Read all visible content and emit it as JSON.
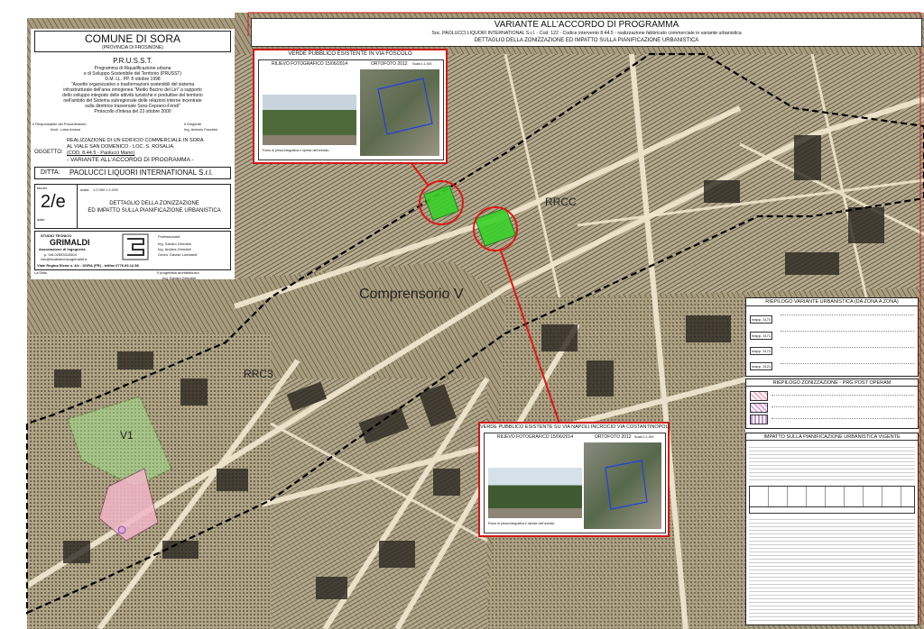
{
  "title_block": {
    "comune": "COMUNE DI SORA",
    "provincia": "(PROVINCIA DI FROSINONE)",
    "prusst": "P.R.U.S.S.T.",
    "prusst_lines": [
      "Programma di Riqualificazione urbana",
      "e di Sviluppo Sostenibile del Territorio (PRUSST)",
      "D.M. LL. PP. 8 ottobre 1998",
      "\"Assetto organizzativo e trasformazioni sostenibili del sistema",
      "infrastrutturale dell'area omogenea \"Medio Bacino del Liri\" a supporto",
      "dello sviluppo integrato delle attività turistiche e produttive del territorio",
      "nell'ambito del Sistema subregionale delle relazioni interne incentrate",
      "sulla direttrice trasversale Sora-Ceprano-Fondi\"",
      "Protocollo d'intesa del 23 ottobre 2000"
    ],
    "responsabile_label": "Il Responsabile del Procedimento",
    "responsabile_name": "Arch. Luisa Arcese",
    "dirigente_label": "Il Dirigente",
    "dirigente_name": "Ing. Antonio Facchini",
    "oggetto_label": "OGGETTO:",
    "oggetto_lines": [
      "REALIZZAZIONE DI UN EDIFICIO COMMERCIALE IN SORA",
      "AL VIALE SAN DOMENICO - LOC. S. ROSALIA,",
      "(COD. 8.44.5 - Paolucci Mario)",
      "- VARIANTE ALL'ACCORDO DI PROGRAMMA -"
    ],
    "ditta_label": "DITTA:",
    "ditta_value": "PAOLUCCI LIQUORI INTERNATIONAL S.r.l.",
    "tavola_label": "tavola",
    "tavola_value": "2/e",
    "data_label": "data:",
    "scala_label": "scala",
    "scala_value": "1:2.000 1:1.000",
    "tavola_title": [
      "DETTAGLIO DELLA ZONIZZAZIONE",
      "ED IMPATTO SULLA PIANIFICAZIONE URBANISTICA"
    ],
    "studio_label": "STUDIO TECNICO",
    "studio_name": "GRIMALDI",
    "studio_sub": "Associazione di Ingegneria",
    "studio_lines": [
      "p. IVA 02553310604",
      "info@studiotecnicogrimaldi.it",
      "Viale Regina Elena n. 4/c  - SORA (FR) -  telifax 0776.83.12.58"
    ],
    "professionisti_label": "Professionisti:",
    "professionisti": [
      "Ing. Sandro Grimaldi",
      "Ing. Andrea Grimaldi",
      "Geom. Davide Lombardi"
    ],
    "progettista_label": "Il progettista architettonico",
    "progettista_name": "Ing. Sandro Grimaldi",
    "ditta_sign": "La Ditta"
  },
  "header": {
    "title": "VARIANTE ALL'ACCORDO DI PROGRAMMA",
    "subtitle": "Soc. PAOLUCCI LIQUORI INTERNATIONAL S.r.l. - Cod. 122 - Codice intervento 8.44.5 - realizzazione fabbricato commerciale in variante urbanistica",
    "subtitle2": "DETTAGLIO DELLA ZONIZZAZIONE ED IMPATTO SULLA PIANIFICAZIONE URBANISTICA"
  },
  "inset_foscolo": {
    "title": "VERDE PUBBLICO ESISTENTE IN VIA FOSCOLO",
    "rilievo": "RILIEVO FOTOGRAFICO 15/06/2014",
    "ortofoto": "ORTOFOTO 2012",
    "scala": "Scala 1:1.000",
    "caption": "Punto di presa fotografica e riprese nell'ortofoto"
  },
  "inset_napoli": {
    "title": "VERDE PUBBLICO ESISTENTE SU VIA NAPOLI INCROCIO VIA COSTANTINOPOLI",
    "rilievo": "RILIEVO FOTOGRAFICO 15/06/2014",
    "ortofoto": "ORTOFOTO 2012",
    "scala": "Scala 1:1.000",
    "caption": "Punto di presa fotografica e riprese nell'ortofoto"
  },
  "map_labels": {
    "rrcc": "RRCC",
    "comprensorio": "Comprensorio V",
    "rrc3": "RRC3",
    "v1": "V1"
  },
  "right_panel": {
    "riepilogo_variante_title": "RIEPILOGO VARIANTE URBANISTICA (DA ZONA A ZONA)",
    "variante_rows": [
      {
        "mapp": "mapp. 3170"
      },
      {
        "mapp": "mapp. 3171"
      },
      {
        "mapp": "mapp. 3173"
      },
      {
        "mapp": "mapp. 3121"
      }
    ],
    "riepilogo_zonizzazione_title": "RIEPILOGO ZONIZZAZIONE - PRG POST OPERAM",
    "zonizzazione_rows": [
      {
        "color": "#f2b6c6"
      },
      {
        "color": "#d9a7e0"
      },
      {
        "color": "#c8d6a0"
      }
    ],
    "impatto_title": "IMPATTO SULLA PIANIFICAZIONE URBANISTICA VIGENTE"
  },
  "colors": {
    "map_bg": "#a89c7e",
    "hatch": "#2b2620",
    "green_area": "#3ad12a",
    "red_circle": "#e01616",
    "boundary": "#000000",
    "legend_pink": "#f2b6c6",
    "legend_purple": "#d9a7e0"
  }
}
